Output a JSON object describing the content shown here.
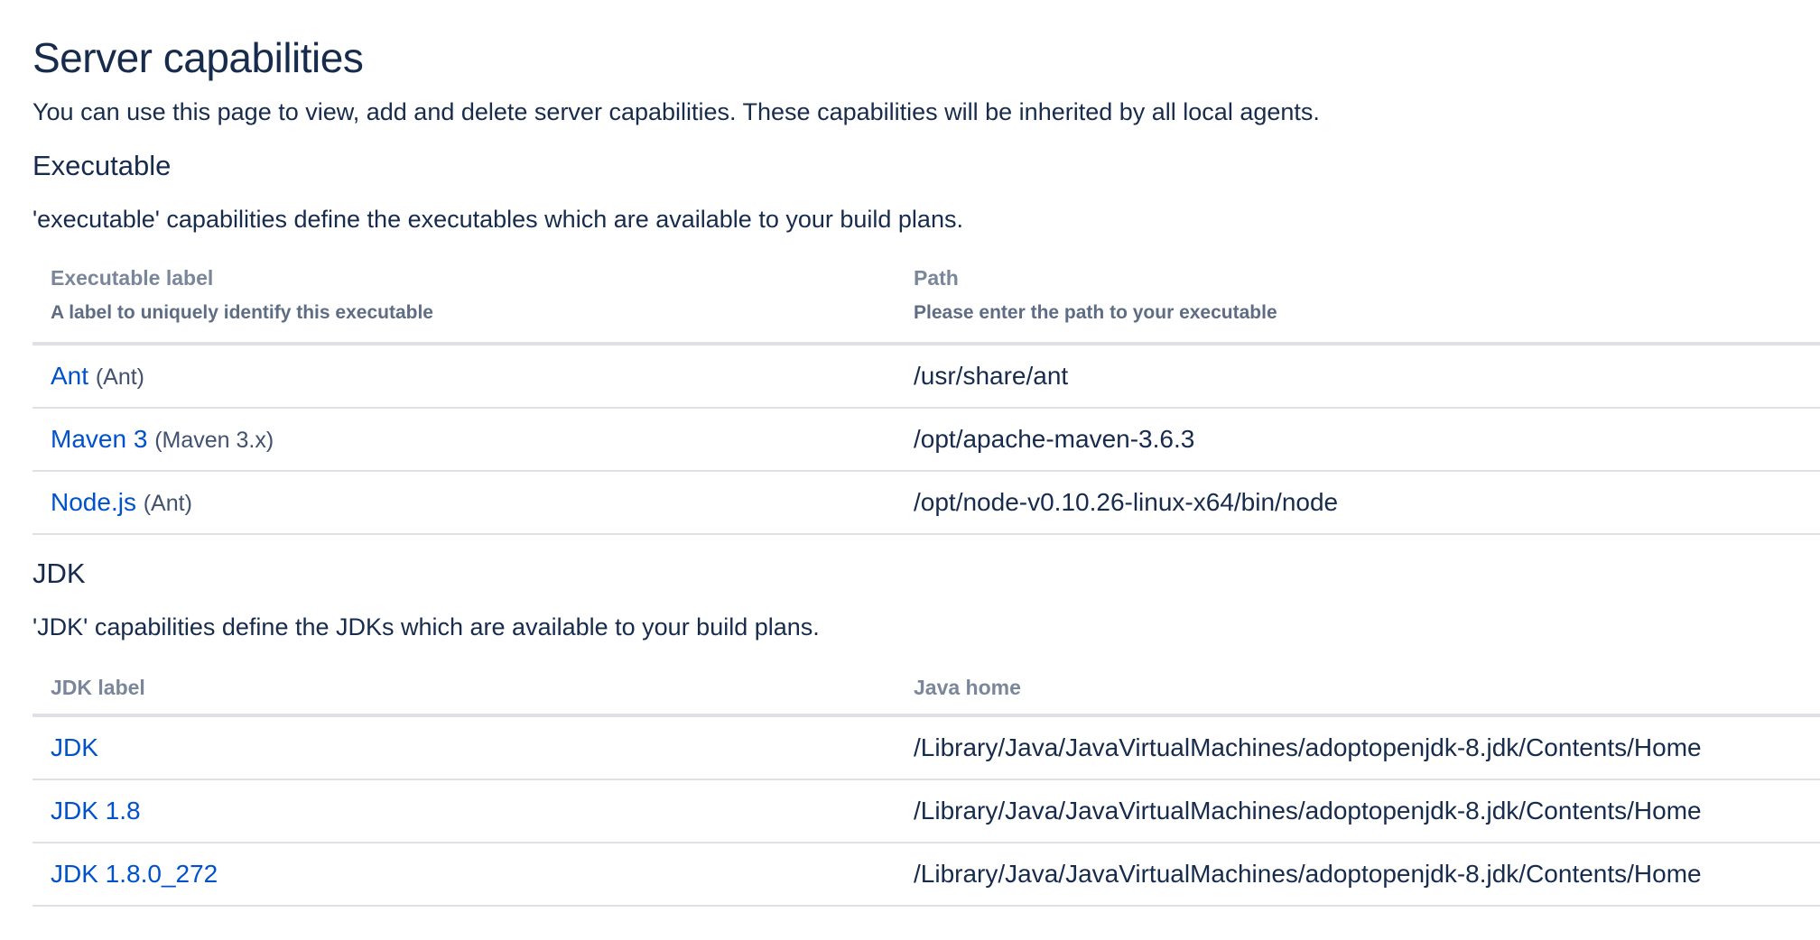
{
  "page": {
    "title": "Server capabilities",
    "intro": "You can use this page to view, add and delete server capabilities. These capabilities will be inherited by all local agents."
  },
  "executable": {
    "title": "Executable",
    "description": "'executable' capabilities define the executables which are available to your build plans.",
    "columns": {
      "label_header": "Executable label",
      "label_help": "A label to uniquely identify this executable",
      "path_header": "Path",
      "path_help": "Please enter the path to your executable"
    },
    "rows": [
      {
        "label": "Ant",
        "type": "(Ant)",
        "path": "/usr/share/ant"
      },
      {
        "label": "Maven 3",
        "type": "(Maven 3.x)",
        "path": "/opt/apache-maven-3.6.3"
      },
      {
        "label": "Node.js",
        "type": "(Ant)",
        "path": "/opt/node-v0.10.26-linux-x64/bin/node"
      }
    ]
  },
  "jdk": {
    "title": "JDK",
    "description": "'JDK' capabilities define the JDKs which are available to your build plans.",
    "columns": {
      "label_header": "JDK label",
      "path_header": "Java home"
    },
    "rows": [
      {
        "label": "JDK",
        "path": "/Library/Java/JavaVirtualMachines/adoptopenjdk-8.jdk/Contents/Home"
      },
      {
        "label": "JDK 1.8",
        "path": "/Library/Java/JavaVirtualMachines/adoptopenjdk-8.jdk/Contents/Home"
      },
      {
        "label": "JDK 1.8.0_272",
        "path": "/Library/Java/JavaVirtualMachines/adoptopenjdk-8.jdk/Contents/Home"
      }
    ]
  },
  "colors": {
    "text": "#172b4d",
    "link": "#0052cc",
    "header_text": "#7a869a",
    "border": "#dfe1e6"
  }
}
